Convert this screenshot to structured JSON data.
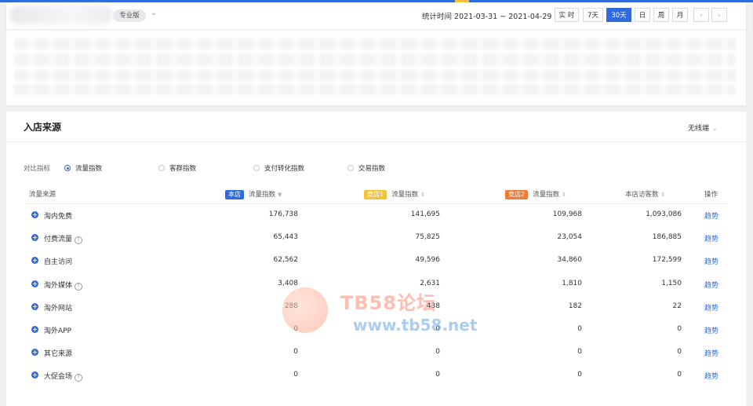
{
  "header": {
    "edition": "专业版",
    "stat_time": "统计时间 2021-03-31 ~ 2021-04-29",
    "ranges": [
      "实 时",
      "7天",
      "30天",
      "日",
      "周",
      "月"
    ],
    "active_range": "30天",
    "prev": "‹",
    "next": "›"
  },
  "source": {
    "title": "入店来源",
    "device": "无线端",
    "metric_label": "对比指标",
    "metrics": [
      "流量指数",
      "客群指数",
      "支付转化指数",
      "交易指数"
    ],
    "selected_metric": "流量指数",
    "columns": {
      "source": "流量来源",
      "shop_badge": "本店",
      "comp1_badge": "竞店1",
      "comp2_badge": "竞店2",
      "flow_index": "流量指数",
      "visitors": "本店访客数",
      "action": "操作"
    },
    "rows": [
      {
        "name": "淘内免费",
        "help": false,
        "own": "176,738",
        "c1": "141,695",
        "c2": "109,968",
        "visitors": "1,093,086",
        "action": "趋势"
      },
      {
        "name": "付费流量",
        "help": true,
        "own": "65,443",
        "c1": "75,825",
        "c2": "23,054",
        "visitors": "186,885",
        "action": "趋势"
      },
      {
        "name": "自主访问",
        "help": false,
        "own": "62,562",
        "c1": "49,596",
        "c2": "34,860",
        "visitors": "172,599",
        "action": "趋势"
      },
      {
        "name": "淘外媒体",
        "help": true,
        "own": "3,408",
        "c1": "2,631",
        "c2": "1,810",
        "visitors": "1,150",
        "action": "趋势"
      },
      {
        "name": "淘外网站",
        "help": false,
        "own": "288",
        "c1": "438",
        "c2": "182",
        "visitors": "22",
        "action": "趋势"
      },
      {
        "name": "淘外APP",
        "help": false,
        "own": "0",
        "c1": "0",
        "c2": "0",
        "visitors": "0",
        "action": "趋势"
      },
      {
        "name": "其它来源",
        "help": false,
        "own": "0",
        "c1": "0",
        "c2": "0",
        "visitors": "0",
        "action": "趋势"
      },
      {
        "name": "大促会场",
        "help": true,
        "own": "0",
        "c1": "0",
        "c2": "0",
        "visitors": "0",
        "action": "趋势"
      }
    ]
  },
  "watermark": {
    "line1": "TB58论坛",
    "line2": "www.tb58.net"
  },
  "colors": {
    "accent": "#2f6bdc",
    "shop": "#2f6bdc",
    "comp1": "#f5c33b",
    "comp2": "#f07a3a"
  }
}
